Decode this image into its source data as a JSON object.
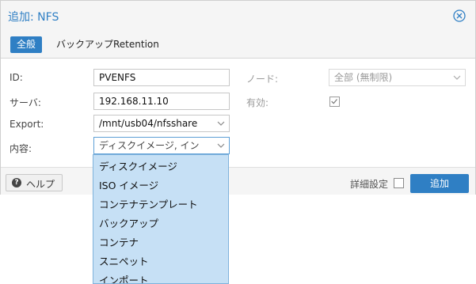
{
  "dialog": {
    "title": "追加: NFS",
    "close_icon": "close-circle-icon",
    "tabs": [
      "全般",
      "バックアップRetention"
    ]
  },
  "form": {
    "id": {
      "label": "ID:",
      "value": "PVENFS"
    },
    "server": {
      "label": "サーバ:",
      "value": "192.168.11.10"
    },
    "export": {
      "label": "Export:",
      "value": "/mnt/usb04/nfsshare"
    },
    "content": {
      "label": "内容:",
      "value": "ディスクイメージ, イン"
    },
    "node": {
      "label": "ノード:",
      "value": "全部 (無制限)"
    },
    "enabled": {
      "label": "有効:",
      "checked": true
    }
  },
  "content_options": [
    "ディスクイメージ",
    "ISO イメージ",
    "コンテナテンプレート",
    "バックアップ",
    "コンテナ",
    "スニペット",
    "インポート"
  ],
  "footer": {
    "help_label": "ヘルプ",
    "help_icon": "help-icon",
    "advanced_label": "詳細設定",
    "advanced_checked": false,
    "add_label": "追加"
  },
  "colors": {
    "accent": "#2f7fc4",
    "dropdown_bg": "#c6e0f5"
  }
}
